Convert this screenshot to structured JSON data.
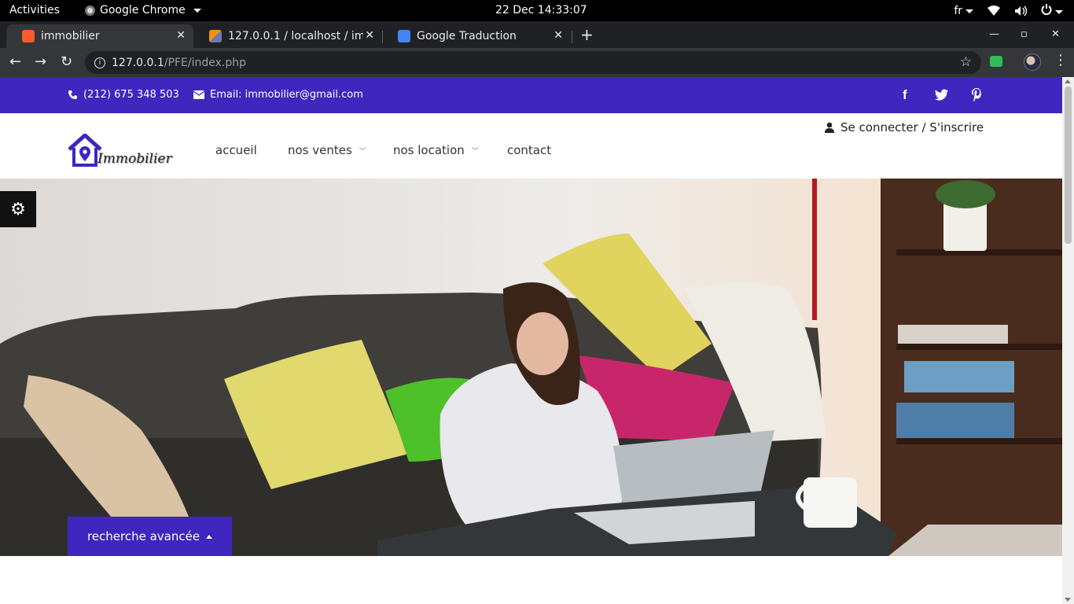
{
  "system_bar": {
    "activities": "Activities",
    "app_name": "Google Chrome",
    "datetime": "22 Dec  14:33:07",
    "keyboard_lang": "fr"
  },
  "browser": {
    "tabs": [
      {
        "title": "immobilier",
        "active": true,
        "favicon_color": "#fb5a2b"
      },
      {
        "title": "127.0.0.1 / localhost / imm",
        "active": false,
        "favicon_color": "#f29111"
      },
      {
        "title": "Google Traduction",
        "active": false,
        "favicon_color": "#4285f4"
      }
    ],
    "url_host": "127.0.0.1",
    "url_path": "/PFE/index.php"
  },
  "site": {
    "accent_color": "#3f26be",
    "infobar": {
      "phone": "(212) 675 348 503",
      "email": "Email: immobilier@gmail.com",
      "social": [
        "facebook-icon",
        "twitter-icon",
        "pinterest-icon"
      ]
    },
    "logo_text": "Immobilier",
    "nav": [
      {
        "label": "accueil",
        "dropdown": false
      },
      {
        "label": "nos ventes",
        "dropdown": true
      },
      {
        "label": "nos location",
        "dropdown": true
      },
      {
        "label": "contact",
        "dropdown": false
      }
    ],
    "login": "Se connecter / S'inscrire",
    "search_button": "recherche avancée"
  }
}
